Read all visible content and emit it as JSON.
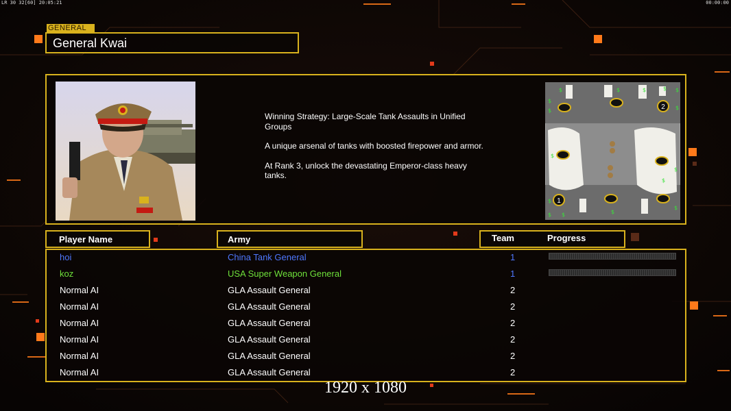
{
  "hud": {
    "left_status": "LR 30 32[60] 20:05:21",
    "right_status": "00:00:00"
  },
  "general": {
    "tag": "GENERAL",
    "name": "General Kwai",
    "description": [
      "Winning Strategy: Large-Scale Tank Assaults in Unified Groups",
      "A unique arsenal of tanks with boosted firepower and armor.",
      "At Rank 3, unlock the devastating Emperor-class heavy tanks."
    ]
  },
  "minimap": {
    "start_labels": [
      "2",
      "1"
    ]
  },
  "table": {
    "headers": {
      "player": "Player Name",
      "army": "Army",
      "team": "Team",
      "progress": "Progress"
    },
    "rows": [
      {
        "name": "hoi",
        "army": "China Tank General",
        "team": "1",
        "color": "#4f78ff",
        "progress": 0
      },
      {
        "name": "koz",
        "army": "USA Super Weapon General",
        "team": "1",
        "color": "#6ee03a",
        "progress": 0
      },
      {
        "name": "Normal AI",
        "army": "GLA Assault General",
        "team": "2",
        "color": "#ffffff"
      },
      {
        "name": "Normal AI",
        "army": "GLA Assault General",
        "team": "2",
        "color": "#ffffff"
      },
      {
        "name": "Normal AI",
        "army": "GLA Assault General",
        "team": "2",
        "color": "#ffffff"
      },
      {
        "name": "Normal AI",
        "army": "GLA Assault General",
        "team": "2",
        "color": "#ffffff"
      },
      {
        "name": "Normal AI",
        "army": "GLA Assault General",
        "team": "2",
        "color": "#ffffff"
      },
      {
        "name": "Normal AI",
        "army": "GLA Assault General",
        "team": "2",
        "color": "#ffffff"
      }
    ]
  },
  "resolution_label": "1920 x 1080",
  "colors": {
    "gold": "#d9b21d",
    "accent_orange": "#ff7a1a"
  }
}
